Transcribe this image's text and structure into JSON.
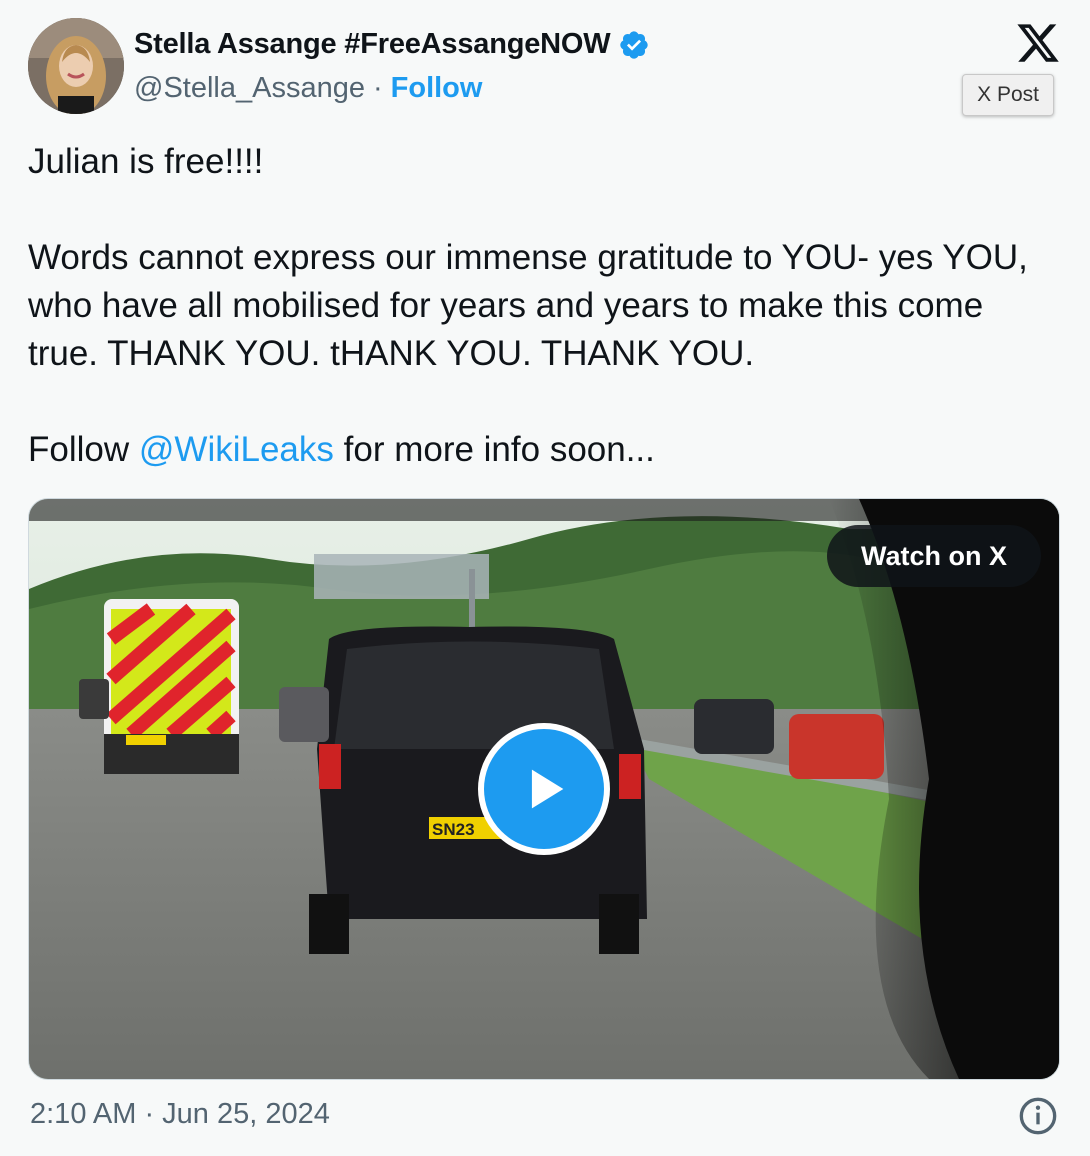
{
  "author": {
    "display_name": "Stella Assange #FreeAssangeNOW",
    "handle": "@Stella_Assange",
    "separator": "·",
    "follow_label": "Follow",
    "verified_color": "#1d9bf0"
  },
  "platform": {
    "logo_icon": "x-logo-icon",
    "tooltip": "X Post"
  },
  "tweet": {
    "line1": "Julian is free!!!!",
    "paragraph2": "Words cannot express our immense gratitude to YOU- yes YOU, who have all mobilised for years and years to make this come true. THANK YOU. tHANK YOU. THANK YOU.",
    "follow_prefix": "Follow",
    "mention": "@WikiLeaks",
    "follow_suffix": "for more info soon..."
  },
  "media": {
    "watch_label": "Watch on X",
    "play_icon": "play-icon",
    "plate_text": "SN23"
  },
  "footer": {
    "timestamp": "2:10 AM · Jun 25, 2024",
    "info_icon": "info-icon"
  },
  "colors": {
    "accent": "#1d9bf0",
    "text": "#0f1419",
    "muted": "#536471",
    "background": "#f7f9f9"
  }
}
